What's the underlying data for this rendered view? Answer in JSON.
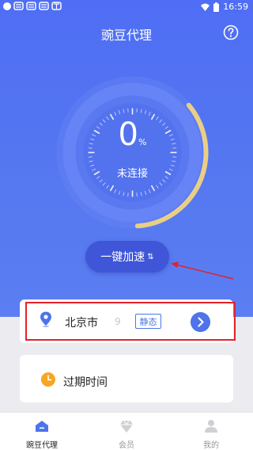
{
  "status_bar": {
    "time": "16:59",
    "icons": [
      "notification-dot-icon",
      "app-notification-icon",
      "app-notification-icon",
      "app-notification-icon",
      "app-notification-icon",
      "wifi-icon",
      "battery-icon"
    ]
  },
  "header": {
    "title": "豌豆代理",
    "help_icon": "question-circle-icon"
  },
  "gauge": {
    "value": "0",
    "unit": "%",
    "status": "未连接",
    "progress_fraction": 0.35,
    "ring_color": "#e9cf86"
  },
  "boost_button": {
    "label": "一键加速",
    "icon": "swap-arrows-icon"
  },
  "location_card": {
    "icon": "map-pin-icon",
    "city": "北京市",
    "code_fragment": "9",
    "mode": "静态",
    "next_icon": "chevron-right-icon"
  },
  "expire_card": {
    "icon": "clock-icon",
    "label": "过期时间"
  },
  "tabs": [
    {
      "label": "豌豆代理",
      "icon": "home-icon",
      "active": true
    },
    {
      "label": "会员",
      "icon": "diamond-icon",
      "active": false
    },
    {
      "label": "我的",
      "icon": "user-icon",
      "active": false
    }
  ],
  "colors": {
    "hero_blue": "#5577f0",
    "button_blue": "#3f56d8",
    "accent_blue": "#4e73eb",
    "annotation_red": "#e3222b",
    "clock_orange": "#f5a623"
  }
}
